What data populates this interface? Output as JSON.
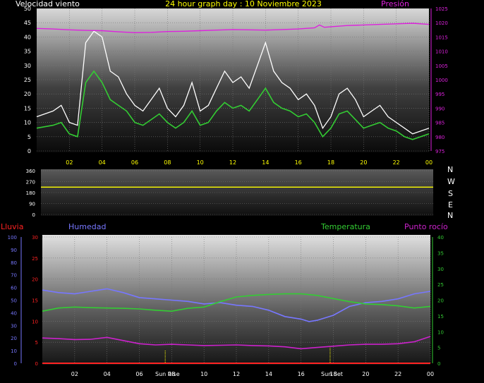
{
  "title": "24 hour graph day : 10 Noviembre 2023",
  "colors": {
    "wind": "#ffffff",
    "wind_avg": "#33cc33",
    "pressure": "#dd22dd",
    "direction": "#ffff00",
    "rain": "#ff2222",
    "humidity": "#7777ff",
    "temperature": "#33cc33",
    "dewpoint": "#cc22cc",
    "sun": "#ffff00",
    "grid": "#777777",
    "axis_left": "#ffffff",
    "axis_pressure": "#dd22dd"
  },
  "chart_data": [
    {
      "type": "line",
      "panel": "wind",
      "left_label": "Velocidad viento",
      "right_label": "Presión",
      "x_ticks": [
        "02",
        "04",
        "06",
        "08",
        "10",
        "12",
        "14",
        "16",
        "18",
        "20",
        "22",
        "00"
      ],
      "y_left_ticks": [
        "50",
        "45",
        "40",
        "35",
        "30",
        "25",
        "20",
        "15",
        "10",
        "5",
        "0"
      ],
      "y_left_range": [
        0,
        50
      ],
      "y_right_ticks": [
        "1025",
        "1020",
        "1015",
        "1010",
        "1005",
        "1000",
        "995",
        "990",
        "985",
        "980",
        "975"
      ],
      "y_right_range": [
        975,
        1025
      ],
      "series": [
        {
          "key": "gust",
          "hours": [
            0,
            1,
            1.5,
            2,
            2.5,
            3,
            3.5,
            4,
            4.5,
            5,
            5.5,
            6,
            6.5,
            7,
            7.5,
            8,
            8.5,
            9,
            9.5,
            10,
            10.5,
            11,
            11.5,
            12,
            12.5,
            13,
            13.5,
            14,
            14.5,
            15,
            15.5,
            16,
            16.5,
            17,
            17.5,
            18,
            18.5,
            19,
            19.5,
            20,
            20.5,
            21,
            21.5,
            22,
            22.5,
            23,
            24
          ],
          "values": [
            12,
            14,
            16,
            10,
            9,
            38,
            42,
            40,
            28,
            26,
            20,
            16,
            14,
            18,
            22,
            15,
            12,
            16,
            24,
            14,
            16,
            22,
            28,
            24,
            26,
            22,
            30,
            38,
            28,
            24,
            22,
            18,
            20,
            16,
            8,
            12,
            20,
            22,
            18,
            12,
            14,
            16,
            12,
            10,
            8,
            6,
            8
          ]
        },
        {
          "key": "avg",
          "hours": [
            0,
            1,
            1.5,
            2,
            2.5,
            3,
            3.5,
            4,
            4.5,
            5,
            5.5,
            6,
            6.5,
            7,
            7.5,
            8,
            8.5,
            9,
            9.5,
            10,
            10.5,
            11,
            11.5,
            12,
            12.5,
            13,
            13.5,
            14,
            14.5,
            15,
            15.5,
            16,
            16.5,
            17,
            17.5,
            18,
            18.5,
            19,
            19.5,
            20,
            20.5,
            21,
            21.5,
            22,
            22.5,
            23,
            24
          ],
          "values": [
            8,
            9,
            10,
            6,
            5,
            24,
            28,
            24,
            18,
            16,
            14,
            10,
            9,
            11,
            13,
            10,
            8,
            10,
            14,
            9,
            10,
            14,
            17,
            15,
            16,
            14,
            18,
            22,
            17,
            15,
            14,
            12,
            13,
            10,
            5,
            8,
            13,
            14,
            11,
            8,
            9,
            10,
            8,
            7,
            5,
            4,
            6
          ]
        },
        {
          "key": "pressure",
          "hours": [
            0,
            1,
            2,
            3,
            4,
            5,
            6,
            7,
            8,
            9,
            10,
            11,
            12,
            13,
            14,
            15,
            16,
            17,
            17.3,
            17.6,
            18,
            19,
            20,
            21,
            22,
            23,
            24
          ],
          "values": [
            1018,
            1017.8,
            1017.5,
            1017.3,
            1017.2,
            1016.8,
            1016.5,
            1016.6,
            1016.9,
            1017.0,
            1017.2,
            1017.4,
            1017.6,
            1017.5,
            1017.4,
            1017.6,
            1017.8,
            1018.2,
            1019.2,
            1018.4,
            1018.6,
            1019.0,
            1019.2,
            1019.4,
            1019.6,
            1019.8,
            1019.4
          ]
        }
      ]
    },
    {
      "type": "line",
      "panel": "direction",
      "y_ticks": [
        "360",
        "270",
        "180",
        "90",
        "0"
      ],
      "y_range": [
        0,
        360
      ],
      "compass": [
        "N",
        "W",
        "S",
        "E",
        "N"
      ],
      "series": [
        {
          "key": "direction",
          "hours": [
            0,
            24
          ],
          "values": [
            225,
            225
          ]
        }
      ]
    },
    {
      "type": "line",
      "panel": "weather",
      "rain_label": "Lluvia",
      "humidity_label": "Humedad",
      "temperature_label": "Temperatura",
      "dewpoint_label": "Punto rocío",
      "x_ticks": [
        "02",
        "04",
        "06",
        "08",
        "10",
        "12",
        "14",
        "16",
        "18",
        "20",
        "22",
        "00"
      ],
      "humidity_ticks": [
        "100",
        "90",
        "80",
        "70",
        "60",
        "50",
        "40",
        "30",
        "20",
        "10",
        "0"
      ],
      "humidity_range": [
        0,
        100
      ],
      "rain_ticks": [
        "30",
        "25",
        "20",
        "15",
        "10",
        "5",
        "0"
      ],
      "rain_range": [
        0,
        30
      ],
      "temp_ticks": [
        "40",
        "35",
        "30",
        "25",
        "20",
        "15",
        "10",
        "5",
        "0"
      ],
      "temp_range": [
        0,
        40
      ],
      "sun_rise_label": "Sun Rise",
      "sun_set_label": "Sun Set",
      "sun_rise_hour": 7.6,
      "sun_set_hour": 17.8,
      "series": [
        {
          "key": "humidity",
          "hours": [
            0,
            1,
            2,
            3,
            4,
            5,
            6,
            7,
            8,
            9,
            10,
            11,
            12,
            13,
            14,
            15,
            16,
            16.5,
            17,
            18,
            19,
            20,
            21,
            22,
            23,
            24
          ],
          "values": [
            58,
            56,
            55,
            57,
            59,
            56,
            52,
            51,
            50,
            49,
            47,
            48,
            46,
            45,
            42,
            37,
            35,
            33,
            34,
            38,
            45,
            48,
            49,
            51,
            55,
            57
          ]
        },
        {
          "key": "temperature",
          "hours": [
            0,
            1,
            2,
            3,
            4,
            5,
            6,
            7,
            8,
            9,
            10,
            11,
            12,
            13,
            14,
            15,
            16,
            17,
            18,
            19,
            20,
            21,
            22,
            23,
            24
          ],
          "values": [
            16.5,
            17.5,
            17.8,
            17.6,
            17.5,
            17.4,
            17.2,
            16.8,
            16.5,
            17.4,
            17.8,
            19.5,
            21.0,
            21.5,
            21.8,
            22.0,
            22.0,
            21.5,
            20.5,
            19.5,
            18.8,
            18.6,
            18.2,
            17.5,
            18.0
          ]
        },
        {
          "key": "dewpoint",
          "hours": [
            0,
            1,
            2,
            3,
            4,
            5,
            6,
            7,
            8,
            9,
            10,
            11,
            12,
            13,
            14,
            15,
            16,
            17,
            18,
            19,
            20,
            21,
            22,
            23,
            24
          ],
          "values": [
            8.0,
            7.8,
            7.5,
            7.6,
            8.2,
            7.2,
            6.2,
            5.8,
            6.0,
            5.8,
            5.6,
            5.7,
            5.8,
            5.6,
            5.5,
            5.2,
            4.6,
            5.0,
            5.4,
            5.8,
            6.0,
            6.0,
            6.2,
            6.8,
            8.5
          ]
        },
        {
          "key": "rain",
          "hours": [
            0,
            24
          ],
          "values": [
            0,
            0
          ]
        }
      ]
    }
  ]
}
